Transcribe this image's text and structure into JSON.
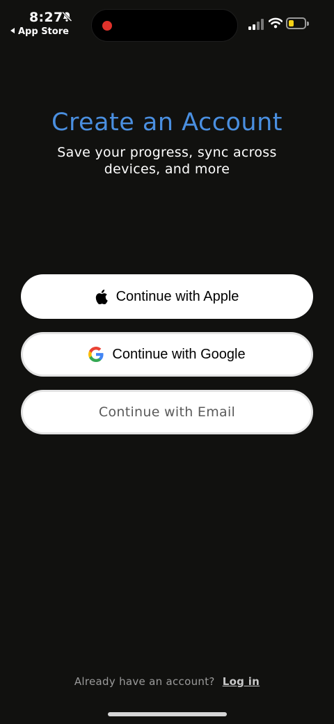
{
  "status_bar": {
    "time": "8:27",
    "back_label": "App Store",
    "battery_color": "#f6d216",
    "recording_color": "#e0322b"
  },
  "header": {
    "title": "Create an Account",
    "subtitle": "Save your progress, sync across devices, and more",
    "title_color": "#4a8fe0"
  },
  "buttons": {
    "apple": {
      "label": "Continue with Apple",
      "icon": "apple-icon"
    },
    "google": {
      "label": "Continue with Google",
      "icon": "google-icon"
    },
    "email": {
      "label": "Continue with Email"
    }
  },
  "footer": {
    "prompt": "Already have an account?",
    "login_label": "Log in"
  }
}
